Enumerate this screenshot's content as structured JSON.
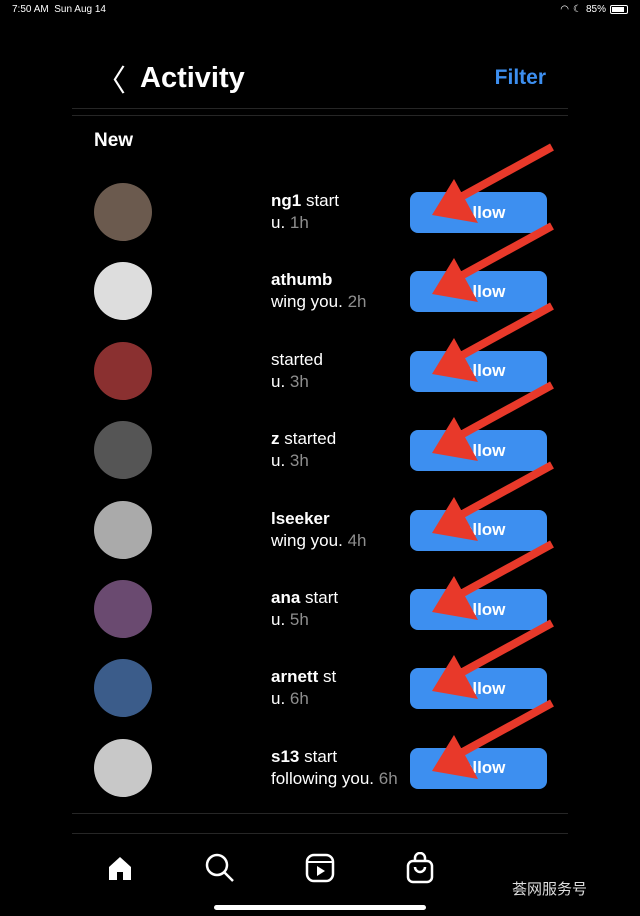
{
  "status": {
    "time": "7:50 AM",
    "date": "Sun Aug 14",
    "battery": "85%"
  },
  "header": {
    "title": "Activity",
    "filter": "Filter"
  },
  "section": "New",
  "rows": [
    {
      "name": "ng1",
      "action": " start",
      "line2": "u.",
      "time": "1h",
      "follow": "Follow",
      "avatar": "#6b5a4e"
    },
    {
      "name": "athumb",
      "action": "",
      "line2": "wing you.",
      "time": "2h",
      "follow": "Follow",
      "avatar": "#ddd"
    },
    {
      "name": "",
      "action": "started",
      "line2": "u.",
      "time": "3h",
      "follow": "Follow",
      "avatar": "#8a3030"
    },
    {
      "name": "z",
      "action": " started",
      "line2": "u.",
      "time": "3h",
      "follow": "Follow",
      "avatar": "#555"
    },
    {
      "name": "lseeker",
      "action": "",
      "line2": "wing you.",
      "time": "4h",
      "follow": "Follow",
      "avatar": "#aaa"
    },
    {
      "name": "ana",
      "action": " start",
      "line2": "u.",
      "time": "5h",
      "follow": "Follow",
      "avatar": "#6a4a70"
    },
    {
      "name": "arnett",
      "action": " st",
      "line2": "u.",
      "time": "6h",
      "follow": "Follow",
      "avatar": "#3b5c8a"
    },
    {
      "name": "s13",
      "action": " start",
      "line2": "following you.",
      "time": "6h",
      "follow": "Follow",
      "avatar": "#c8c8c8"
    }
  ],
  "watermark": "荟网服务号",
  "colors": {
    "accent": "#3d8ff0",
    "arrow": "#e8392a"
  }
}
